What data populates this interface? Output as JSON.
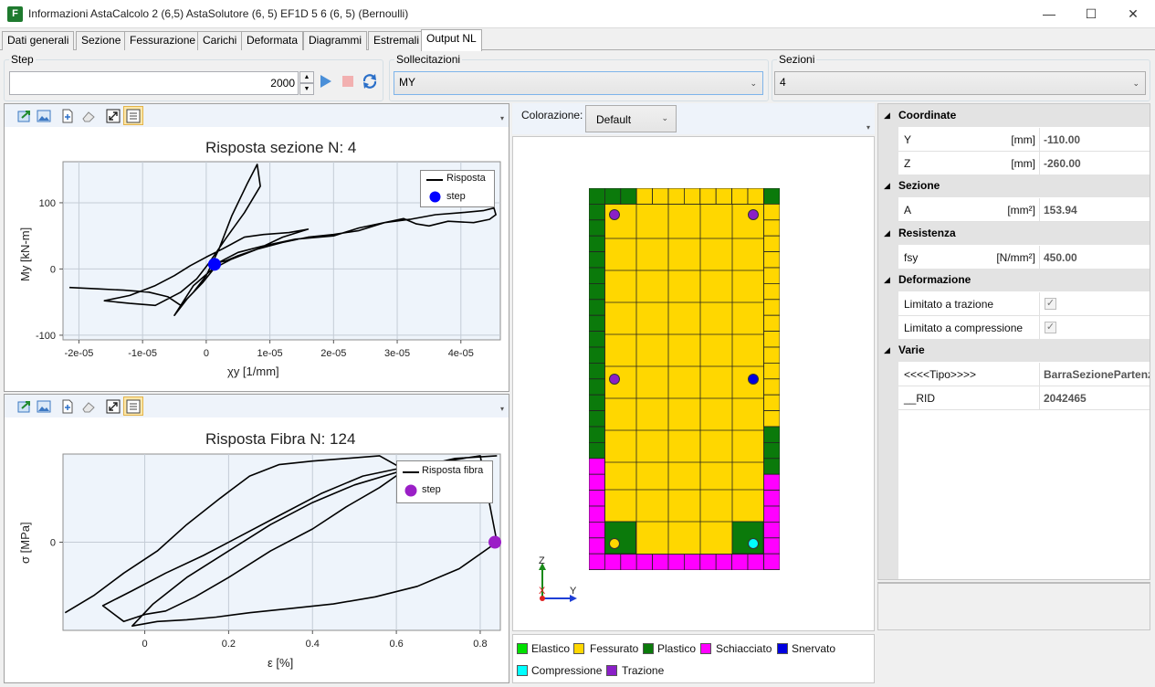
{
  "window": {
    "title": "Informazioni AstaCalcolo 2 (6,5) AstaSolutore (6, 5) EF1D 5 6  (6, 5) (Bernoulli)",
    "icon_letter": "F",
    "controls": {
      "minimize": "—",
      "maximize": "☐",
      "close": "✕"
    }
  },
  "tabs": [
    {
      "label": "Dati generali"
    },
    {
      "label": "Sezione"
    },
    {
      "label": "Fessurazione"
    },
    {
      "label": "Carichi"
    },
    {
      "label": "Deformata"
    },
    {
      "label": "Diagrammi"
    },
    {
      "label": "Estremali"
    },
    {
      "label": "Output NL",
      "active": true
    }
  ],
  "step": {
    "group_label": "Step",
    "value": "2000"
  },
  "sollecitazioni": {
    "group_label": "Sollecitazioni",
    "selected": "MY"
  },
  "sezioni": {
    "group_label": "Sezioni",
    "selected": "4"
  },
  "colorazione": {
    "label": "Colorazione:",
    "selected": "Default"
  },
  "chart_data": [
    {
      "type": "line",
      "title": "Risposta sezione N: 4",
      "xlabel": "χy [1/mm]",
      "ylabel": "My [kN-m]",
      "xlim": [
        -2.25e-05,
        4.62e-05
      ],
      "ylim": [
        -107,
        162
      ],
      "x_ticks": [
        "-2e-05",
        "-1e-05",
        "0",
        "1e-05",
        "2e-05",
        "3e-05",
        "4e-05"
      ],
      "x_tick_values": [
        -2e-05,
        -1e-05,
        0,
        1e-05,
        2e-05,
        3e-05,
        4e-05
      ],
      "y_ticks": [
        "100",
        "0",
        "-100"
      ],
      "y_tick_values": [
        100,
        0,
        -100
      ],
      "grid": true,
      "legend_position": "top-right",
      "series": [
        {
          "name": "Risposta",
          "color": "#000000",
          "x": [
            -2.15e-05,
            -1.7e-05,
            -1.3e-05,
            -9e-06,
            -6e-06,
            -4e-06,
            -2e-06,
            0,
            2e-06,
            4e-06,
            6.5e-06,
            8e-06,
            8.5e-06,
            6e-06,
            3e-06,
            5e-07,
            -1.5e-06,
            -4e-06,
            -8e-06,
            -1.2e-05,
            -1.6e-05,
            -1.2e-05,
            -8e-06,
            -5e-06,
            -2.5e-06,
            0,
            2.5e-06,
            6e-06,
            9e-06,
            1.3e-05,
            1.6e-05,
            1.2e-05,
            8e-06,
            4e-06,
            1e-06,
            -2e-06,
            -5e-06,
            -3e-06,
            -5e-07,
            2e-06,
            5e-06,
            9e-06,
            1.4e-05,
            2e-05,
            2.4e-05,
            2.8e-05,
            3.2e-05,
            3.6e-05,
            4e-05,
            4.35e-05,
            4.52e-05,
            4.55e-05,
            4.45e-05,
            4.2e-05,
            3.8e-05,
            3.5e-05,
            3.3e-05,
            3.1e-05,
            2.8e-05,
            2.4e-05,
            2e-05,
            1.6e-05,
            1.2e-05,
            8e-06,
            5e-06,
            3e-06,
            1e-06
          ],
          "y": [
            -28,
            -30,
            -32,
            -35,
            -42,
            -55,
            -35,
            -10,
            30,
            80,
            130,
            158,
            125,
            85,
            45,
            10,
            -15,
            -35,
            -55,
            -52,
            -48,
            -40,
            -25,
            -10,
            5,
            18,
            30,
            48,
            52,
            55,
            60,
            48,
            30,
            15,
            0,
            -25,
            -70,
            -45,
            -20,
            10,
            25,
            35,
            45,
            50,
            62,
            70,
            75,
            82,
            85,
            88,
            92,
            82,
            75,
            70,
            72,
            65,
            68,
            76,
            70,
            58,
            52,
            48,
            40,
            30,
            20,
            12,
            8
          ]
        },
        {
          "name": "step",
          "color": "#0000ff",
          "marker": true,
          "x": [
            1.3e-06
          ],
          "y": [
            7
          ]
        }
      ]
    },
    {
      "type": "line",
      "title": "Risposta Fibra N: 124",
      "xlabel": "ε [%]",
      "ylabel": "σ [MPa]",
      "xlim": [
        -0.195,
        0.848
      ],
      "ylim": [
        -1,
        1
      ],
      "x_ticks": [
        "0",
        "0.2",
        "0.4",
        "0.6",
        "0.8"
      ],
      "x_tick_values": [
        0,
        0.2,
        0.4,
        0.6,
        0.8
      ],
      "y_ticks": [
        "0"
      ],
      "y_tick_values": [
        0
      ],
      "grid": true,
      "legend_position": "top-right",
      "series": [
        {
          "name": "Risposta fibra",
          "color": "#000000",
          "x": [
            -0.19,
            -0.12,
            -0.05,
            0.03,
            0.1,
            0.18,
            0.25,
            0.32,
            0.4,
            0.48,
            0.56,
            0.62,
            0.56,
            0.48,
            0.4,
            0.3,
            0.2,
            0.12,
            0.05,
            0.0,
            -0.05,
            -0.1,
            -0.03,
            0.05,
            0.14,
            0.22,
            0.32,
            0.42,
            0.52,
            0.62,
            0.72,
            0.8,
            0.84,
            0.75,
            0.65,
            0.55,
            0.45,
            0.35,
            0.25,
            0.17,
            0.1,
            0.03,
            -0.03,
            0.02,
            0.1,
            0.2,
            0.3,
            0.4,
            0.5,
            0.62,
            0.74,
            0.84
          ],
          "y": [
            -0.8,
            -0.6,
            -0.35,
            -0.1,
            0.2,
            0.5,
            0.75,
            0.88,
            0.92,
            0.95,
            0.98,
            0.82,
            0.62,
            0.4,
            0.15,
            -0.1,
            -0.4,
            -0.62,
            -0.78,
            -0.82,
            -0.9,
            -0.72,
            -0.55,
            -0.35,
            -0.15,
            0.05,
            0.3,
            0.55,
            0.75,
            0.85,
            0.92,
            0.98,
            0.0,
            -0.3,
            -0.5,
            -0.62,
            -0.7,
            -0.75,
            -0.8,
            -0.85,
            -0.88,
            -0.9,
            -0.95,
            -0.7,
            -0.4,
            -0.1,
            0.2,
            0.45,
            0.65,
            0.82,
            0.95,
            0.98
          ]
        },
        {
          "name": "step",
          "color": "#9b1fc7",
          "marker": true,
          "x": [
            0.835
          ],
          "y": [
            0.0
          ]
        }
      ]
    }
  ],
  "section_view": {
    "axis_labels": {
      "z": "Z",
      "y": "Y",
      "x": "X"
    },
    "colors": {
      "elastico": "#00e000",
      "fessurato": "#ffd700",
      "plastico": "#0b7a0b",
      "schiacciato": "#ff00ff",
      "snervato": "#0000e0",
      "compressione": "#00ffff",
      "trazione": "#8a1fc7"
    },
    "bars": [
      {
        "pos": "top-left",
        "fill": "trazione"
      },
      {
        "pos": "top-right",
        "fill": "trazione"
      },
      {
        "pos": "mid-left",
        "fill": "trazione"
      },
      {
        "pos": "mid-right",
        "fill": "snervato"
      },
      {
        "pos": "bottom-left",
        "fill": "fessurato"
      },
      {
        "pos": "bottom-right",
        "fill": "compressione"
      }
    ]
  },
  "section_legend": [
    {
      "label": "Elastico",
      "color": "#00e000"
    },
    {
      "label": "Fessurato",
      "color": "#ffd700"
    },
    {
      "label": "Plastico",
      "color": "#0b7a0b"
    },
    {
      "label": "Schiacciato",
      "color": "#ff00ff"
    },
    {
      "label": "Snervato",
      "color": "#0000e0"
    },
    {
      "label": "Compressione",
      "color": "#00ffff"
    },
    {
      "label": "Trazione",
      "color": "#8a1fc7"
    }
  ],
  "property_grid": [
    {
      "category": "Coordinate",
      "rows": [
        {
          "name": "Y",
          "unit": "[mm]",
          "value": "-110.00"
        },
        {
          "name": "Z",
          "unit": "[mm]",
          "value": "-260.00"
        }
      ]
    },
    {
      "category": "Sezione",
      "rows": [
        {
          "name": "A",
          "unit": "[mm²]",
          "value": "153.94"
        }
      ]
    },
    {
      "category": "Resistenza",
      "rows": [
        {
          "name": "fsy",
          "unit": "[N/mm²]",
          "value": "450.00"
        }
      ]
    },
    {
      "category": "Deformazione",
      "rows": [
        {
          "name": "Limitato a trazione",
          "unit": "",
          "value": "",
          "checkbox": true
        },
        {
          "name": "Limitato a compressione",
          "unit": "",
          "value": "",
          "checkbox": true
        }
      ]
    },
    {
      "category": "Varie",
      "rows": [
        {
          "name": "<<<<Tipo>>>>",
          "unit": "",
          "value": "BarraSezionePartenza"
        },
        {
          "name": "__RID",
          "unit": "",
          "value": "2042465"
        }
      ]
    }
  ]
}
